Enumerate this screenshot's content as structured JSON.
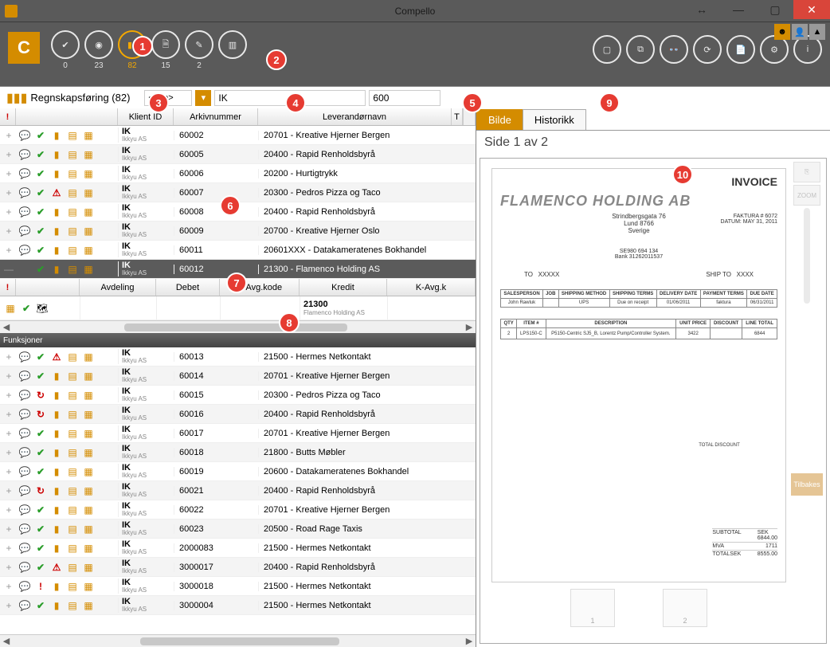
{
  "window": {
    "title": "Compello"
  },
  "top_counts": [
    "0",
    "23",
    "82",
    "15",
    "2"
  ],
  "filter": {
    "section": "Regnskapsføring (82)",
    "combo": "<Alle>",
    "client": "IK",
    "archive": "600"
  },
  "columns": {
    "client": "Klient ID",
    "archive": "Arkivnummer",
    "vendor": "Leverandørnavn",
    "t": "T"
  },
  "rows_top": [
    {
      "client_id": "IK",
      "client_name": "Ikkyu AS",
      "archive": "60002",
      "vendor": "20701 - Kreative Hjerner Bergen",
      "icons": [
        "plus",
        "chat",
        "check",
        "doc",
        "badge",
        "badge2"
      ]
    },
    {
      "client_id": "IK",
      "client_name": "Ikkyu AS",
      "archive": "60005",
      "vendor": "20400 - Rapid Renholdsbyrå",
      "icons": [
        "plus",
        "chat",
        "check",
        "doc",
        "badge",
        "badge2"
      ]
    },
    {
      "client_id": "IK",
      "client_name": "Ikkyu AS",
      "archive": "60006",
      "vendor": "20200 - Hurtigtrykk",
      "icons": [
        "plus",
        "chat",
        "check",
        "doc",
        "badge",
        "badge2"
      ]
    },
    {
      "client_id": "IK",
      "client_name": "Ikkyu AS",
      "archive": "60007",
      "vendor": "20300 - Pedros Pizza og Taco",
      "icons": [
        "plus",
        "chat",
        "check",
        "warn",
        "badge",
        "badge2"
      ]
    },
    {
      "client_id": "IK",
      "client_name": "Ikkyu AS",
      "archive": "60008",
      "vendor": "20400 - Rapid Renholdsbyrå",
      "icons": [
        "plus",
        "chat",
        "check",
        "doc",
        "badge",
        "badge2"
      ]
    },
    {
      "client_id": "IK",
      "client_name": "Ikkyu AS",
      "archive": "60009",
      "vendor": "20700 - Kreative Hjerner Oslo",
      "icons": [
        "plus",
        "chat",
        "check",
        "doc",
        "badge",
        "badge2"
      ]
    },
    {
      "client_id": "IK",
      "client_name": "Ikkyu AS",
      "archive": "60011",
      "vendor": "20601XXX - Datakameratenes Bokhandel",
      "icons": [
        "plus",
        "chat",
        "check",
        "doc",
        "badge",
        "badge2"
      ]
    }
  ],
  "row_selected": {
    "client_id": "IK",
    "client_name": "Ikkyu AS",
    "archive": "60012",
    "vendor": "21300 - Flamenco Holding AS",
    "icons": [
      "minus",
      "blank",
      "check",
      "doc",
      "badge",
      "badge2"
    ]
  },
  "sub_columns": [
    "!",
    "Avdeling",
    "Debet",
    "D-Avg.kode",
    "Kredit",
    "K-Avg.k"
  ],
  "sub_row": {
    "kredit_code": "21300",
    "kredit_name": "Flamenco Holding AS"
  },
  "funksjoner": "Funksjoner",
  "rows_bottom": [
    {
      "client_id": "IK",
      "client_name": "Ikkyu AS",
      "archive": "60013",
      "vendor": "21500 - Hermes Netkontakt",
      "icons": [
        "plus",
        "chat",
        "check",
        "warn",
        "badge",
        "badge2"
      ]
    },
    {
      "client_id": "IK",
      "client_name": "Ikkyu AS",
      "archive": "60014",
      "vendor": "20701 - Kreative Hjerner Bergen",
      "icons": [
        "plus",
        "chat",
        "check",
        "doc",
        "badge",
        "badge2"
      ]
    },
    {
      "client_id": "IK",
      "client_name": "Ikkyu AS",
      "archive": "60015",
      "vendor": "20300 - Pedros Pizza og Taco",
      "icons": [
        "plus",
        "chat",
        "refresh",
        "doc",
        "badge",
        "badge2"
      ]
    },
    {
      "client_id": "IK",
      "client_name": "Ikkyu AS",
      "archive": "60016",
      "vendor": "20400 - Rapid Renholdsbyrå",
      "icons": [
        "plus",
        "chat",
        "refresh",
        "doc",
        "badge",
        "badge2"
      ]
    },
    {
      "client_id": "IK",
      "client_name": "Ikkyu AS",
      "archive": "60017",
      "vendor": "20701 - Kreative Hjerner Bergen",
      "icons": [
        "plus",
        "chat",
        "check",
        "doc",
        "badge",
        "badge2"
      ]
    },
    {
      "client_id": "IK",
      "client_name": "Ikkyu AS",
      "archive": "60018",
      "vendor": "21800 - Butts Møbler",
      "icons": [
        "plus",
        "chat",
        "check",
        "doc",
        "badge",
        "badge2"
      ]
    },
    {
      "client_id": "IK",
      "client_name": "Ikkyu AS",
      "archive": "60019",
      "vendor": "20600 - Datakameratenes Bokhandel",
      "icons": [
        "plus",
        "chat",
        "check",
        "doc",
        "badge",
        "badge2"
      ]
    },
    {
      "client_id": "IK",
      "client_name": "Ikkyu AS",
      "archive": "60021",
      "vendor": "20400 - Rapid Renholdsbyrå",
      "icons": [
        "plus",
        "chat",
        "refresh",
        "doc",
        "badge",
        "badge2"
      ]
    },
    {
      "client_id": "IK",
      "client_name": "Ikkyu AS",
      "archive": "60022",
      "vendor": "20701 - Kreative Hjerner Bergen",
      "icons": [
        "plus",
        "chat",
        "check",
        "doc",
        "badge",
        "badge2"
      ]
    },
    {
      "client_id": "IK",
      "client_name": "Ikkyu AS",
      "archive": "60023",
      "vendor": "20500 - Road Rage Taxis",
      "icons": [
        "plus",
        "chat",
        "check",
        "doc",
        "badge",
        "badge2"
      ]
    },
    {
      "client_id": "IK",
      "client_name": "Ikkyu AS",
      "archive": "2000083",
      "vendor": "21500 - Hermes Netkontakt",
      "icons": [
        "plus",
        "chat",
        "check",
        "doc",
        "badge",
        "badge2"
      ]
    },
    {
      "client_id": "IK",
      "client_name": "Ikkyu AS",
      "archive": "3000017",
      "vendor": "20400 - Rapid Renholdsbyrå",
      "icons": [
        "plus",
        "chat",
        "check",
        "warn",
        "badge",
        "badge2"
      ]
    },
    {
      "client_id": "IK",
      "client_name": "Ikkyu AS",
      "archive": "3000018",
      "vendor": "21500 - Hermes Netkontakt",
      "icons": [
        "plus",
        "chat",
        "excl",
        "doc",
        "badge",
        "badge2"
      ]
    },
    {
      "client_id": "IK",
      "client_name": "Ikkyu AS",
      "archive": "3000004",
      "vendor": "21500 - Hermes Netkontakt",
      "icons": [
        "plus",
        "chat",
        "check",
        "doc",
        "badge",
        "badge2"
      ]
    }
  ],
  "right_tabs": {
    "bilde": "Bilde",
    "historikk": "Historikk"
  },
  "page_info": "Side 1 av 2",
  "zoom_label": "ZOOM",
  "tilbakes": "Tilbakes",
  "invoice": {
    "title": "INVOICE",
    "company": "FLAMENCO HOLDING AB",
    "addr1": "Strindbergsgata 76",
    "addr2": "Lund 8766",
    "addr3": "Sverige",
    "faktura": "FAKTURA # 6072",
    "datum": "DATUM: MAY 31, 2011",
    "se": "SE980 694 134",
    "bank": "Bank 31262011537",
    "to_label": "TO",
    "to_val": "XXXXX",
    "ship_label": "SHIP TO",
    "ship_val": "XXXX",
    "head_cols": [
      "SALESPERSON",
      "JOB",
      "SHIPPING METHOD",
      "SHIPPING TERMS",
      "DELIVERY DATE",
      "PAYMENT TERMS",
      "DUE DATE"
    ],
    "head_vals": [
      "John Rawluk",
      "",
      "UPS",
      "Due on receipt",
      "01/06/2011",
      "faktura",
      "06/31/2011"
    ],
    "line_cols": [
      "QTY",
      "ITEM #",
      "DESCRIPTION",
      "UNIT PRICE",
      "DISCOUNT",
      "LINE TOTAL"
    ],
    "line_vals": [
      "2",
      "LPS150-C",
      "P5150-Centric SJ5_B, Lorentz Pump/Controller System.",
      "3422",
      "",
      "6844"
    ],
    "total_disc_label": "TOTAL DISCOUNT",
    "subtotal_label": "SUBTOTAL",
    "subtotal_cur": "SEK",
    "subtotal_val": "6844.00",
    "mva_label": "MVA",
    "mva_val": "1711",
    "total_label": "TOTALSEK",
    "total_val": "8555.00"
  },
  "thumbs": [
    "1",
    "2"
  ],
  "badges": [
    "1",
    "2",
    "3",
    "4",
    "5",
    "6",
    "7",
    "8",
    "9",
    "10"
  ]
}
